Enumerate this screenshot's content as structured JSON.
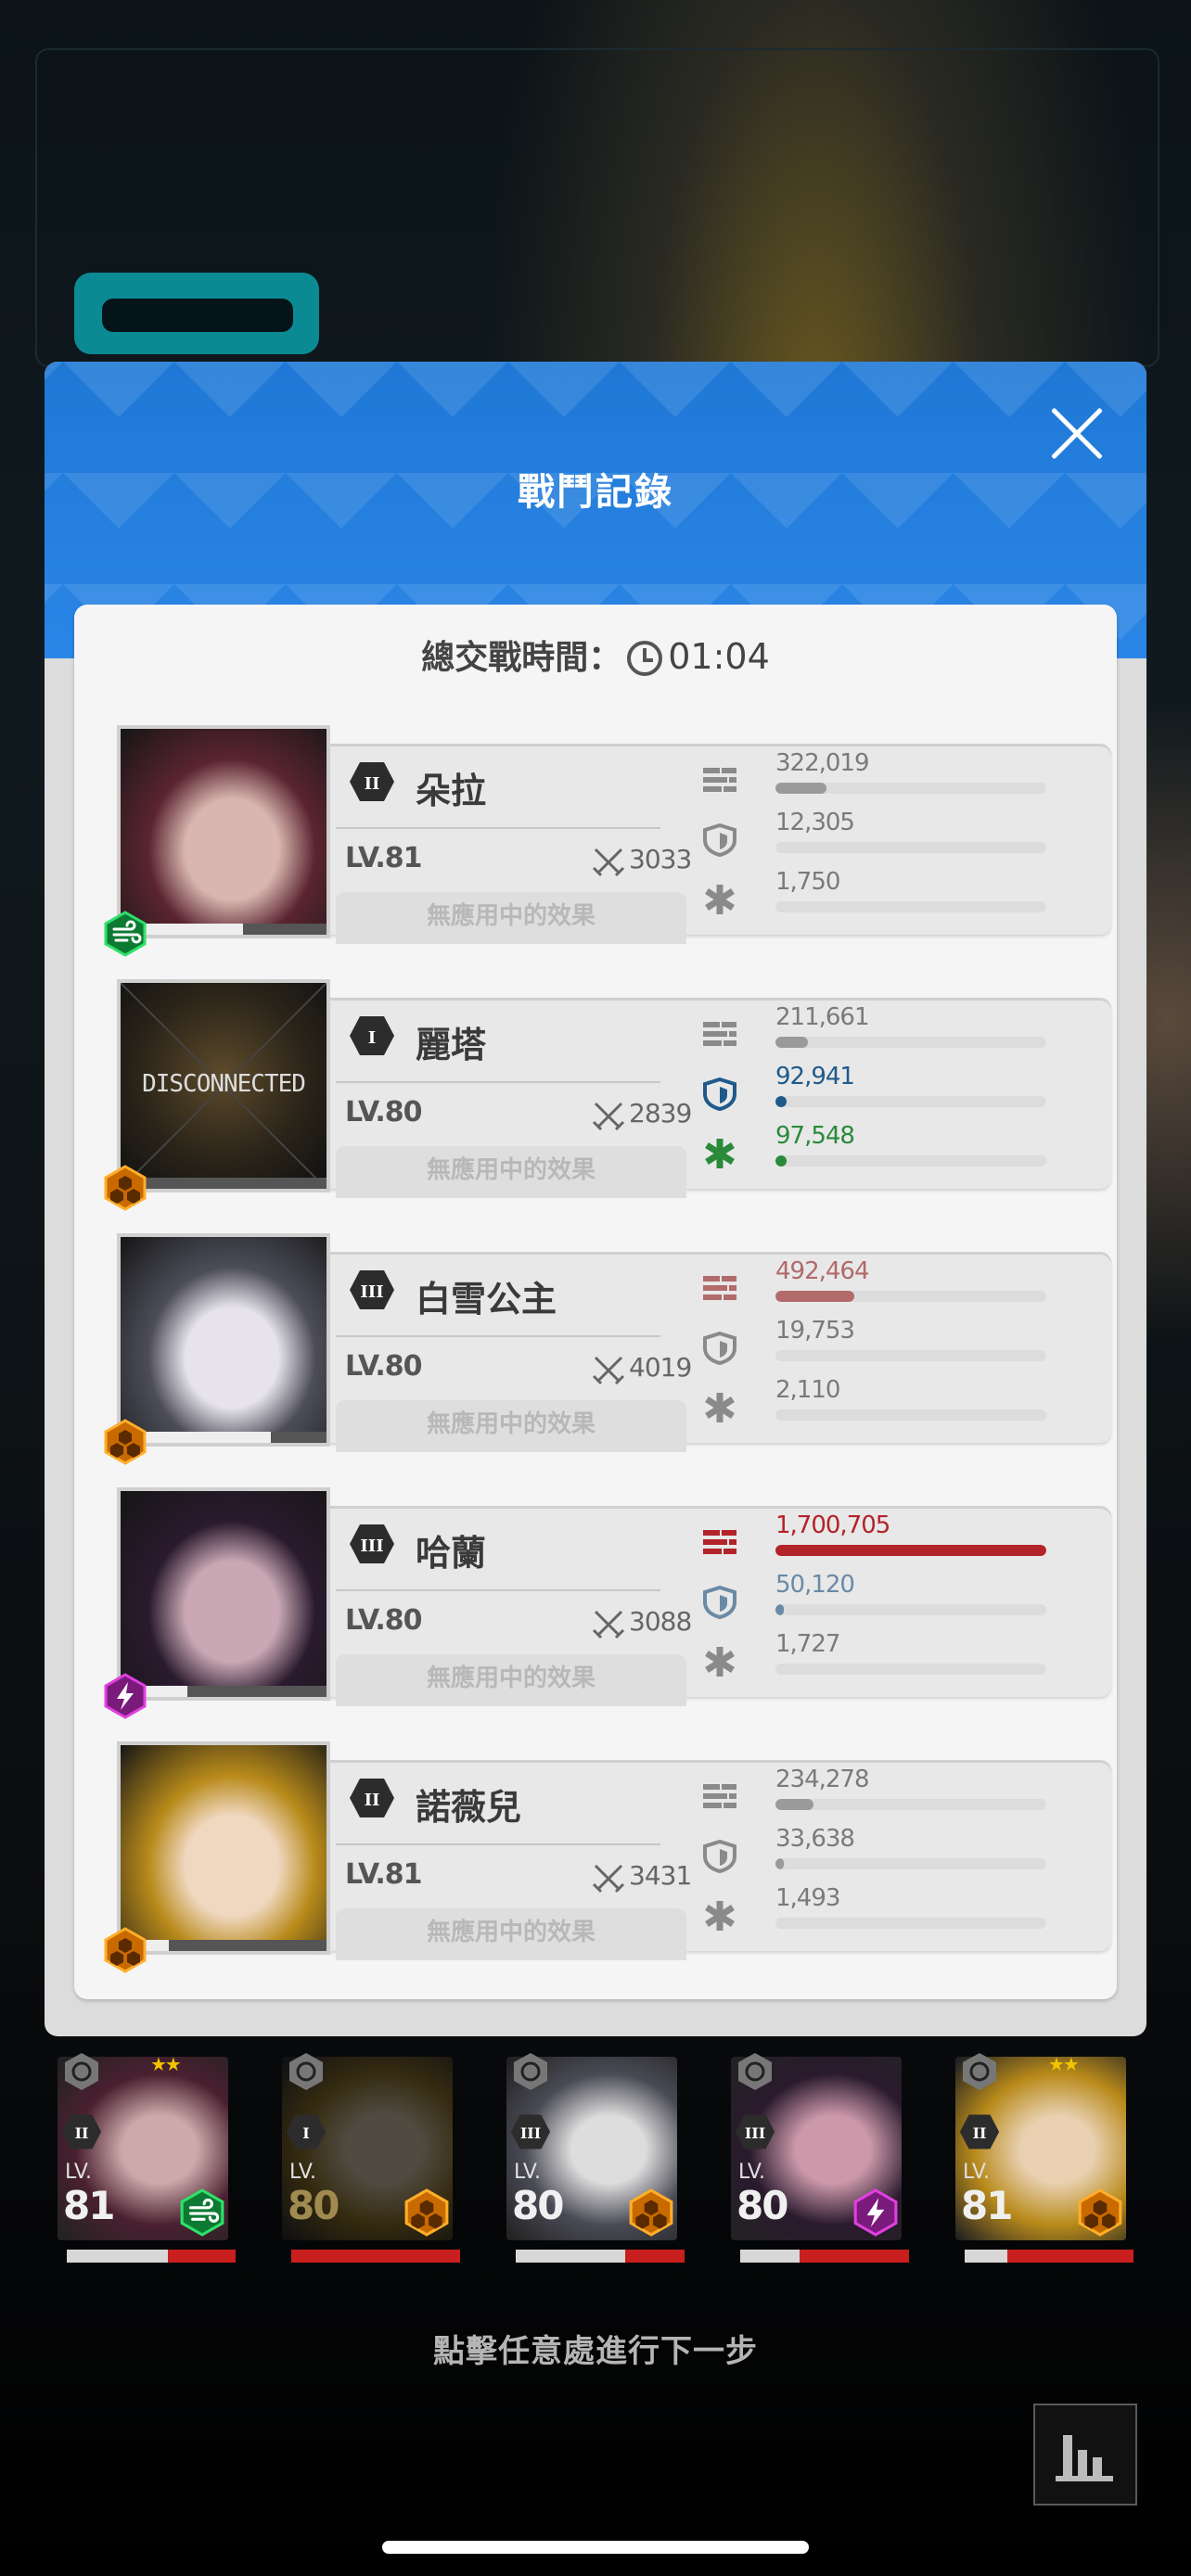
{
  "header": {
    "title": "戰鬥記錄",
    "close_icon": "close-icon"
  },
  "summary": {
    "label": "總交戰時間：",
    "time": "01:04"
  },
  "effect_placeholder": "無應用中的效果",
  "units": [
    {
      "name": "朵拉",
      "burst": "II",
      "level": "LV.81",
      "power": "3033",
      "element": "wind",
      "hp_fraction": 0.55,
      "disconnected": false,
      "portrait_colors": [
        "#5a2430",
        "#d9b7b0"
      ],
      "damage": {
        "value": "322,019",
        "fraction": 0.19,
        "color": "#9a9a9a"
      },
      "taken": {
        "value": "12,305",
        "fraction": 0.0,
        "color": "#9a9a9a"
      },
      "heal": {
        "value": "1,750",
        "fraction": 0.0,
        "color": "#9a9a9a"
      }
    },
    {
      "name": "麗塔",
      "burst": "I",
      "level": "LV.80",
      "power": "2839",
      "element": "iron",
      "hp_fraction": 0.0,
      "disconnected": true,
      "disconnected_label": "DISCONNECTED",
      "portrait_colors": [
        "#2b2419",
        "#5d4b2b"
      ],
      "damage": {
        "value": "211,661",
        "fraction": 0.12,
        "color": "#9a9a9a"
      },
      "taken": {
        "value": "92,941",
        "fraction": 0.04,
        "color": "#1f5a8a"
      },
      "heal": {
        "value": "97,548",
        "fraction": 0.04,
        "color": "#2a8a3a"
      }
    },
    {
      "name": "白雪公主",
      "burst": "III",
      "level": "LV.80",
      "power": "4019",
      "element": "iron",
      "hp_fraction": 0.7,
      "disconnected": false,
      "portrait_colors": [
        "#4d4d5a",
        "#e6e3ea"
      ],
      "damage": {
        "value": "492,464",
        "fraction": 0.29,
        "color": "#b26a6a"
      },
      "taken": {
        "value": "19,753",
        "fraction": 0.0,
        "color": "#9a9a9a"
      },
      "heal": {
        "value": "2,110",
        "fraction": 0.0,
        "color": "#9a9a9a"
      }
    },
    {
      "name": "哈蘭",
      "burst": "III",
      "level": "LV.80",
      "power": "3088",
      "element": "electric",
      "hp_fraction": 0.25,
      "disconnected": false,
      "portrait_colors": [
        "#2a1a2e",
        "#c9a8b4"
      ],
      "damage": {
        "value": "1,700,705",
        "fraction": 1.0,
        "color": "#b3232a"
      },
      "taken": {
        "value": "50,120",
        "fraction": 0.02,
        "color": "#6a8aa6"
      },
      "heal": {
        "value": "1,727",
        "fraction": 0.0,
        "color": "#9a9a9a"
      }
    },
    {
      "name": "諾薇兒",
      "burst": "II",
      "level": "LV.81",
      "power": "3431",
      "element": "iron",
      "hp_fraction": 0.15,
      "disconnected": false,
      "portrait_colors": [
        "#b88a1a",
        "#f0d8c0"
      ],
      "damage": {
        "value": "234,278",
        "fraction": 0.14,
        "color": "#9a9a9a"
      },
      "taken": {
        "value": "33,638",
        "fraction": 0.01,
        "color": "#9a9a9a"
      },
      "heal": {
        "value": "1,493",
        "fraction": 0.0,
        "color": "#9a9a9a"
      }
    }
  ],
  "squad": [
    {
      "burst": "II",
      "lv_label": "LV.",
      "level": "81",
      "element": "wind",
      "hp_fraction": 0.6,
      "dim": false,
      "stars": "★★",
      "colors": [
        "#4a2030",
        "#caa"
      ]
    },
    {
      "burst": "I",
      "lv_label": "LV.",
      "level": "80",
      "element": "iron",
      "hp_fraction": 0.0,
      "dim": true,
      "stars": "",
      "colors": [
        "#8a6a1a",
        "#d8c8a8"
      ]
    },
    {
      "burst": "III",
      "lv_label": "LV.",
      "level": "80",
      "element": "iron",
      "hp_fraction": 0.65,
      "dim": false,
      "stars": "",
      "colors": [
        "#4a4a55",
        "#ddd"
      ]
    },
    {
      "burst": "III",
      "lv_label": "LV.",
      "level": "80",
      "element": "electric",
      "hp_fraction": 0.35,
      "dim": false,
      "stars": "",
      "colors": [
        "#2a1a2e",
        "#c9a"
      ]
    },
    {
      "burst": "II",
      "lv_label": "LV.",
      "level": "81",
      "element": "iron",
      "hp_fraction": 0.25,
      "dim": false,
      "stars": "★★",
      "colors": [
        "#b88a1a",
        "#e8d0b0"
      ]
    }
  ],
  "hint": "點擊任意處進行下一步",
  "stats_button_icon": "bar-chart-icon"
}
